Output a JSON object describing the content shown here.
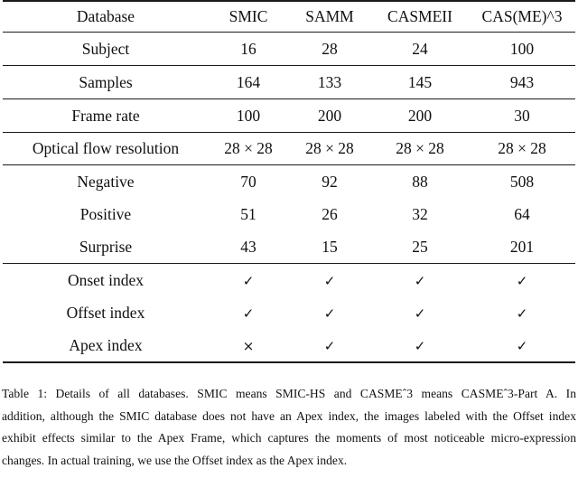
{
  "table": {
    "columns": [
      "Database",
      "SMIC",
      "SAMM",
      "CASMEII",
      "CAS(ME)^3"
    ],
    "rows": [
      {
        "label": "Subject",
        "values": [
          "16",
          "28",
          "24",
          "100"
        ]
      },
      {
        "label": "Samples",
        "values": [
          "164",
          "133",
          "145",
          "943"
        ]
      },
      {
        "label": "Frame rate",
        "values": [
          "100",
          "200",
          "200",
          "30"
        ]
      },
      {
        "label": "Optical flow resolution",
        "values": [
          "28 × 28",
          "28 × 28",
          "28 × 28",
          "28 × 28"
        ]
      },
      {
        "label": "Negative",
        "values": [
          "70",
          "92",
          "88",
          "508"
        ]
      },
      {
        "label": "Positive",
        "values": [
          "51",
          "26",
          "32",
          "64"
        ]
      },
      {
        "label": "Surprise",
        "values": [
          "43",
          "15",
          "25",
          "201"
        ]
      },
      {
        "label": "Onset index",
        "values": [
          "✓",
          "✓",
          "✓",
          "✓"
        ]
      },
      {
        "label": "Offset index",
        "values": [
          "✓",
          "✓",
          "✓",
          "✓"
        ]
      },
      {
        "label": "Apex index",
        "values": [
          "×",
          "✓",
          "✓",
          "✓"
        ]
      }
    ]
  },
  "caption": {
    "line1": "Table 1:  Details of all databases.  SMIC means SMIC-HS and CASMEˆ3 means CASMEˆ3-Part A. In",
    "line2": "addition, although the SMIC database does not have an Apex index, the images labeled with the Offset index",
    "line3": "exhibit effects similar to the Apex Frame, which captures the moments of most noticeable micro-expression",
    "line4": "changes. In actual training, we use the Offset index as the Apex index."
  }
}
